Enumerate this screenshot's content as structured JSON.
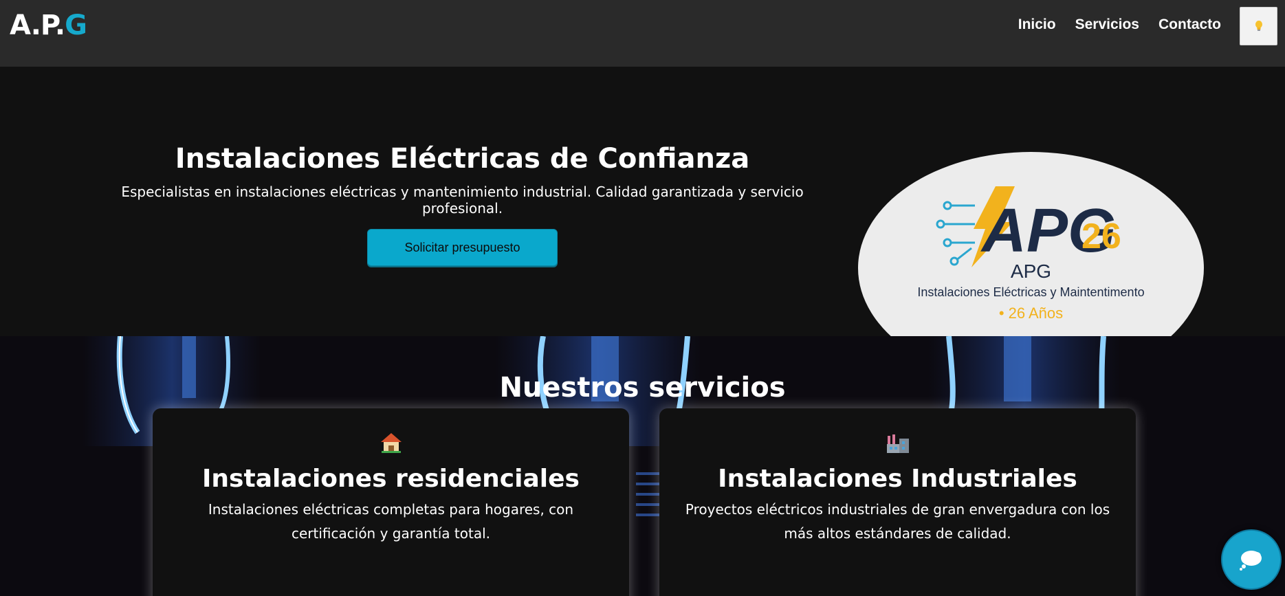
{
  "navbar": {
    "brand_prefix": "A.P.",
    "brand_highlight": "G",
    "links": [
      "Inicio",
      "Servicios",
      "Contacto"
    ],
    "theme_toggle_icon": "lightbulb-icon"
  },
  "hero": {
    "title": "Instalaciones Eléctricas de Confianza",
    "subtitle": "Especialistas en instalaciones eléctricas y mantenimiento industrial. Calidad garantizada y servicio profesional.",
    "cta_label": "Solicitar presupuesto",
    "logo": {
      "mark_text": "APG",
      "mark_number": "26",
      "name": "APG",
      "tagline": "Instalaciones Eléctricas y Maintentimento",
      "years": "• 26 Años"
    }
  },
  "services": {
    "title": "Nuestros servicios",
    "cards": [
      {
        "icon": "house-icon",
        "title": "Instalaciones residenciales",
        "description": "Instalaciones eléctricas completas para hogares, con certificación y garantía total."
      },
      {
        "icon": "factory-icon",
        "title": "Instalaciones Industriales",
        "description": "Proyectos eléctricos industriales de gran envergadura con los más altos estándares de calidad."
      }
    ]
  },
  "chat": {
    "icon": "chat-bubble-icon"
  },
  "colors": {
    "accent": "#0aa8cc",
    "navbar_bg": "#2a2a2a",
    "page_bg": "#111111",
    "logo_yellow": "#f2b21d",
    "logo_navy": "#1d2b46"
  }
}
